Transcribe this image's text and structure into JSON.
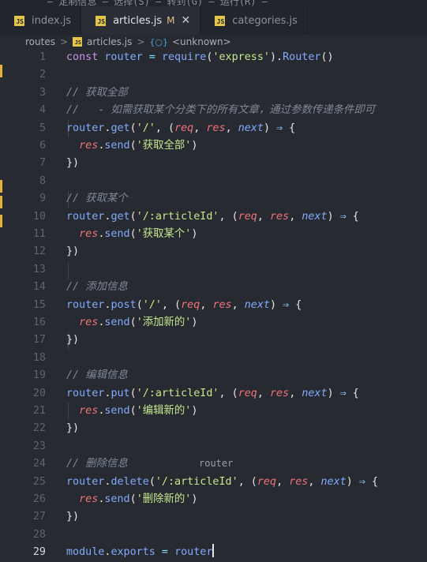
{
  "top_strip_text": "— 定制信息 — 选择(S) — 转到(G) — 运行(R) —",
  "tabs": [
    {
      "label": "index.js",
      "active": false
    },
    {
      "label": "articles.js",
      "active": true,
      "modified": "M",
      "close": "✕"
    },
    {
      "label": "categories.js",
      "active": false
    }
  ],
  "breadcrumb": {
    "folder": "routes",
    "file": "articles.js",
    "symbol": "<unknown>"
  },
  "current_line": 29,
  "lines": [
    {
      "n": 1,
      "tokens": [
        [
          "kw",
          "const "
        ],
        [
          "var",
          "router"
        ],
        [
          "op",
          " = "
        ],
        [
          "fn",
          "require"
        ],
        [
          "pl",
          "("
        ],
        [
          "str",
          "'express'"
        ],
        [
          "pl",
          ")."
        ],
        [
          "fn",
          "Router"
        ],
        [
          "pl",
          "()"
        ]
      ]
    },
    {
      "n": 2,
      "tokens": []
    },
    {
      "n": 3,
      "tokens": [
        [
          "cmt",
          "// 获取全部"
        ]
      ]
    },
    {
      "n": 4,
      "tokens": [
        [
          "cmt",
          "//   - 如需获取某个分类下的所有文章，通过参数传递条件即可"
        ]
      ]
    },
    {
      "n": 5,
      "tokens": [
        [
          "var",
          "router"
        ],
        [
          "pl",
          "."
        ],
        [
          "fn",
          "get"
        ],
        [
          "pl",
          "("
        ],
        [
          "str",
          "'/'"
        ],
        [
          "pl",
          ", ("
        ],
        [
          "par",
          "req"
        ],
        [
          "pl",
          ", "
        ],
        [
          "par",
          "res"
        ],
        [
          "pl",
          ", "
        ],
        [
          "nxt",
          "next"
        ],
        [
          "pl",
          ") "
        ],
        [
          "op",
          "⇒"
        ],
        [
          "pl",
          " {"
        ]
      ]
    },
    {
      "n": 6,
      "tokens": [
        [
          "pl",
          "  "
        ],
        [
          "res",
          "res"
        ],
        [
          "pl",
          "."
        ],
        [
          "fn",
          "send"
        ],
        [
          "pl",
          "("
        ],
        [
          "str",
          "'获取全部'"
        ],
        [
          "pl",
          ")"
        ]
      ]
    },
    {
      "n": 7,
      "tokens": [
        [
          "pl",
          "})"
        ]
      ]
    },
    {
      "n": 8,
      "tokens": []
    },
    {
      "n": 9,
      "tokens": [
        [
          "cmt",
          "// 获取某个"
        ]
      ]
    },
    {
      "n": 10,
      "tokens": [
        [
          "var",
          "router"
        ],
        [
          "pl",
          "."
        ],
        [
          "fn",
          "get"
        ],
        [
          "pl",
          "("
        ],
        [
          "str",
          "'/:articleId'"
        ],
        [
          "pl",
          ", ("
        ],
        [
          "par",
          "req"
        ],
        [
          "pl",
          ", "
        ],
        [
          "par",
          "res"
        ],
        [
          "pl",
          ", "
        ],
        [
          "nxt",
          "next"
        ],
        [
          "pl",
          ") "
        ],
        [
          "op",
          "⇒"
        ],
        [
          "pl",
          " {"
        ]
      ]
    },
    {
      "n": 11,
      "tokens": [
        [
          "pl",
          "  "
        ],
        [
          "res",
          "res"
        ],
        [
          "pl",
          "."
        ],
        [
          "fn",
          "send"
        ],
        [
          "pl",
          "("
        ],
        [
          "str",
          "'获取某个'"
        ],
        [
          "pl",
          ")"
        ]
      ]
    },
    {
      "n": 12,
      "tokens": [
        [
          "pl",
          "})"
        ]
      ]
    },
    {
      "n": 13,
      "tokens": []
    },
    {
      "n": 14,
      "tokens": [
        [
          "cmt",
          "// 添加信息"
        ]
      ]
    },
    {
      "n": 15,
      "tokens": [
        [
          "var",
          "router"
        ],
        [
          "pl",
          "."
        ],
        [
          "fn",
          "post"
        ],
        [
          "pl",
          "("
        ],
        [
          "str",
          "'/'"
        ],
        [
          "pl",
          ", ("
        ],
        [
          "par",
          "req"
        ],
        [
          "pl",
          ", "
        ],
        [
          "par",
          "res"
        ],
        [
          "pl",
          ", "
        ],
        [
          "nxt",
          "next"
        ],
        [
          "pl",
          ") "
        ],
        [
          "op",
          "⇒"
        ],
        [
          "pl",
          " {"
        ]
      ]
    },
    {
      "n": 16,
      "tokens": [
        [
          "pl",
          "  "
        ],
        [
          "res",
          "res"
        ],
        [
          "pl",
          "."
        ],
        [
          "fn",
          "send"
        ],
        [
          "pl",
          "("
        ],
        [
          "str",
          "'添加新的'"
        ],
        [
          "pl",
          ")"
        ]
      ]
    },
    {
      "n": 17,
      "tokens": [
        [
          "pl",
          "})"
        ]
      ]
    },
    {
      "n": 18,
      "tokens": []
    },
    {
      "n": 19,
      "tokens": [
        [
          "cmt",
          "// 编辑信息"
        ]
      ]
    },
    {
      "n": 20,
      "tokens": [
        [
          "var",
          "router"
        ],
        [
          "pl",
          "."
        ],
        [
          "fn",
          "put"
        ],
        [
          "pl",
          "("
        ],
        [
          "str",
          "'/:articleId'"
        ],
        [
          "pl",
          ", ("
        ],
        [
          "par",
          "req"
        ],
        [
          "pl",
          ", "
        ],
        [
          "par",
          "res"
        ],
        [
          "pl",
          ", "
        ],
        [
          "nxt",
          "next"
        ],
        [
          "pl",
          ") "
        ],
        [
          "op",
          "⇒"
        ],
        [
          "pl",
          " {"
        ]
      ]
    },
    {
      "n": 21,
      "tokens": [
        [
          "pl",
          "  "
        ],
        [
          "res",
          "res"
        ],
        [
          "pl",
          "."
        ],
        [
          "fn",
          "send"
        ],
        [
          "pl",
          "("
        ],
        [
          "str",
          "'编辑新的'"
        ],
        [
          "pl",
          ")"
        ]
      ]
    },
    {
      "n": 22,
      "tokens": [
        [
          "pl",
          "})"
        ]
      ]
    },
    {
      "n": 23,
      "tokens": []
    },
    {
      "n": 24,
      "tokens": [
        [
          "cmt",
          "// 删除信息"
        ]
      ]
    },
    {
      "n": 25,
      "tokens": [
        [
          "var",
          "router"
        ],
        [
          "pl",
          "."
        ],
        [
          "fn",
          "delete"
        ],
        [
          "pl",
          "("
        ],
        [
          "str",
          "'/:articleId'"
        ],
        [
          "pl",
          ", ("
        ],
        [
          "par",
          "req"
        ],
        [
          "pl",
          ", "
        ],
        [
          "par",
          "res"
        ],
        [
          "pl",
          ", "
        ],
        [
          "nxt",
          "next"
        ],
        [
          "pl",
          ") "
        ],
        [
          "op",
          "⇒"
        ],
        [
          "pl",
          " {"
        ]
      ]
    },
    {
      "n": 26,
      "tokens": [
        [
          "pl",
          "  "
        ],
        [
          "res",
          "res"
        ],
        [
          "pl",
          "."
        ],
        [
          "fn",
          "send"
        ],
        [
          "pl",
          "("
        ],
        [
          "str",
          "'删除新的'"
        ],
        [
          "pl",
          ")"
        ]
      ]
    },
    {
      "n": 27,
      "tokens": [
        [
          "pl",
          "})"
        ]
      ]
    },
    {
      "n": 28,
      "tokens": []
    },
    {
      "n": 29,
      "tokens": [
        [
          "var",
          "module"
        ],
        [
          "pl",
          "."
        ],
        [
          "var",
          "exports"
        ],
        [
          "op",
          " = "
        ],
        [
          "var",
          "router"
        ]
      ]
    }
  ],
  "autocomplete_hint": "router",
  "colors": {
    "background": "#272a31",
    "tab_bar": "#22252b",
    "keyword": "#c792ea",
    "function": "#82aaff",
    "string": "#c3e88d",
    "parameter": "#f07178",
    "comment": "#7f8897",
    "modified_marker": "#e2c08d",
    "activity_marker": "#e5b33b"
  }
}
